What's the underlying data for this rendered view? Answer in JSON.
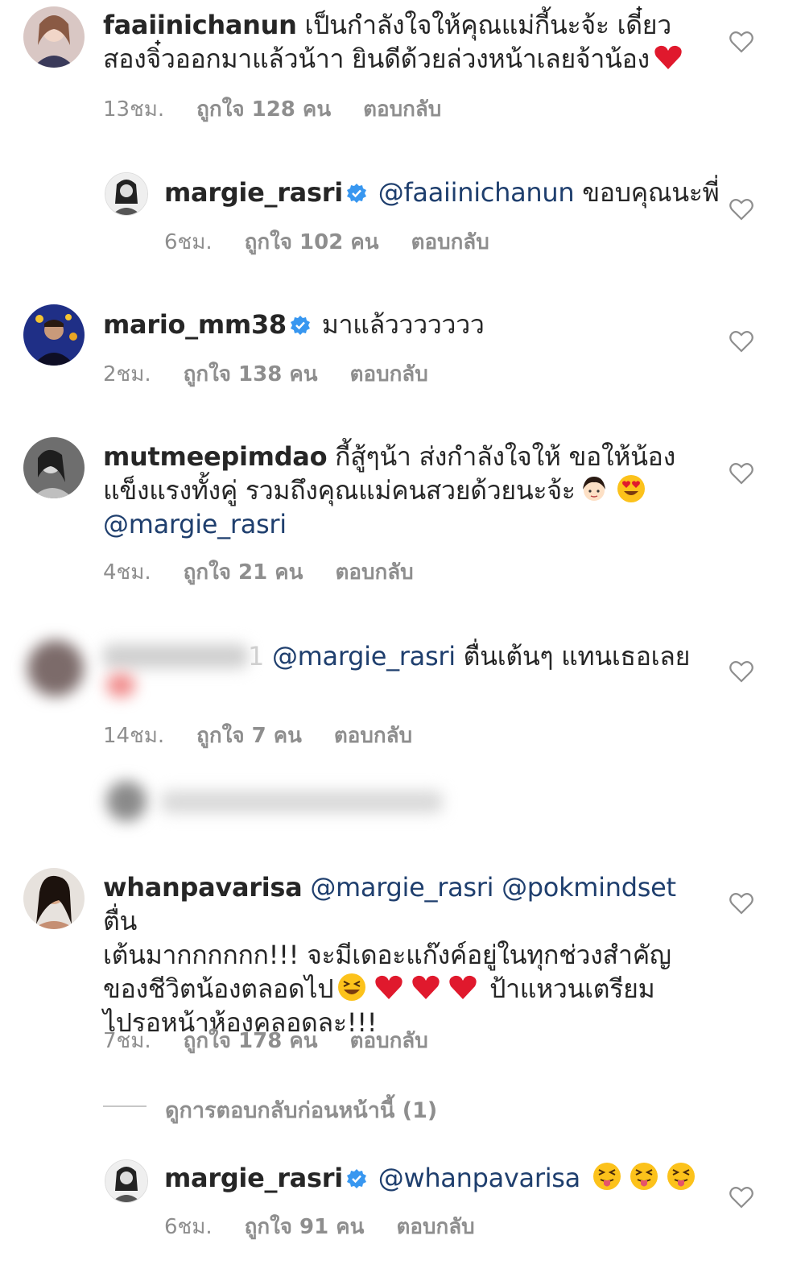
{
  "comments": [
    {
      "username": "faaiinichanun",
      "text_line1": "เป็นกำลังใจให้คุณแม่กี้นะจ้ะ เดี๋ยว",
      "text_line2": "สองจิ๋วออกมาแล้วน้าา ยินดีด้วยล่วงหน้าเลยจ้าน้อง",
      "time": "13ชม.",
      "likes": "ถูกใจ 128 คน",
      "reply": "ตอบกลับ"
    },
    {
      "username": "margie_rasri",
      "mention": "@faaiinichanun",
      "text": "ขอบคุณนะพี่",
      "time": "6ชม.",
      "likes": "ถูกใจ 102 คน",
      "reply": "ตอบกลับ"
    },
    {
      "username": "mario_mm38",
      "text": "มาแล้ววววววว",
      "time": "2ชม.",
      "likes": "ถูกใจ 138 คน",
      "reply": "ตอบกลับ"
    },
    {
      "username": "mutmeepimdao",
      "text_line1": "กี้สู้ๆน้า ส่งกำลังใจให้ ขอให้น้อง",
      "text_line2": "แข็งแรงทั้งคู่ รวมถึงคุณแม่คนสวยด้วยนะจ้ะ",
      "mention": "@margie_rasri",
      "time": "4ชม.",
      "likes": "ถูกใจ 21 คน",
      "reply": "ตอบกลับ"
    },
    {
      "username_suffix": "1",
      "mention": "@margie_rasri",
      "text": "ตื่นเต้นๆ แทนเธอเลย",
      "time": "14ชม.",
      "likes": "ถูกใจ 7 คน",
      "reply": "ตอบกลับ"
    },
    {
      "username": "whanpavarisa",
      "mention1": "@margie_rasri",
      "mention2": "@pokmindset",
      "text_line1_end": "ตื่น",
      "text_line2": "เต้นมากกกกกก!!! จะมีเดอะแก๊งค์อยู่ในทุกช่วงสำคัญ",
      "text_line3_a": "ของชีวิตน้องตลอดไป",
      "text_line3_b": "ป้าแหวนเตรียม",
      "text_line4": "ไปรอหน้าห้องคลอดละ!!!",
      "time": "7ชม.",
      "likes": "ถูกใจ 178 คน",
      "reply": "ตอบกลับ"
    },
    {
      "username": "margie_rasri",
      "mention": "@whanpavarisa",
      "time": "6ชม.",
      "likes": "ถูกใจ 91 คน",
      "reply": "ตอบกลับ"
    }
  ],
  "view_previous_replies": "ดูการตอบกลับก่อนหน้านี้ (1)",
  "colors": {
    "mention": "#1f3f6e",
    "meta": "#8e8e8e",
    "verified": "#3897f0",
    "heart_emoji": "#e0192d"
  }
}
